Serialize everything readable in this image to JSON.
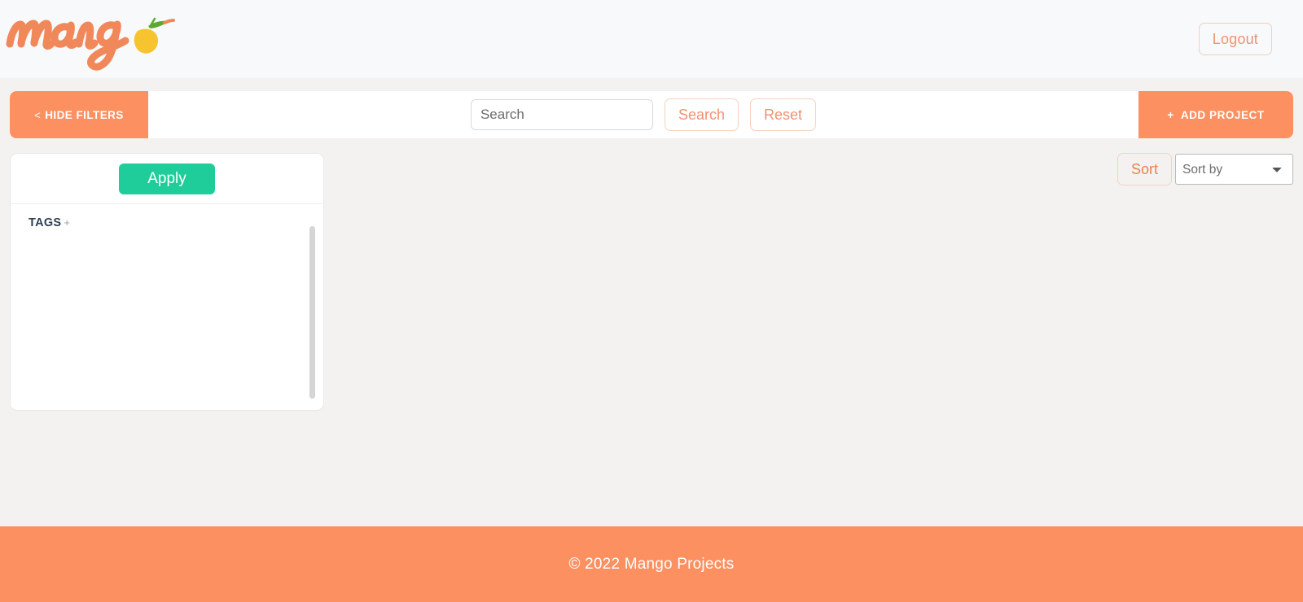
{
  "brand": {
    "logo_text": "mango",
    "logo_icon": "mango-fruit-icon",
    "orange": "#fc9060",
    "green": "#1ecd99",
    "navy": "#2e4153",
    "salmon_text": "#ef9272"
  },
  "header": {
    "logout_label": "Logout"
  },
  "toolbar": {
    "hide_filters_label": "HIDE FILTERS",
    "hide_filters_chevron": "<",
    "search_placeholder": "Search",
    "search_value": "",
    "search_button_label": "Search",
    "reset_button_label": "Reset",
    "add_project_label": "ADD PROJECT",
    "add_project_plus": "+"
  },
  "filters": {
    "apply_label": "Apply",
    "tags_label": "TAGS",
    "tags_add_icon": "+",
    "tags": []
  },
  "sort": {
    "sort_button_label": "Sort",
    "select_placeholder": "Sort by",
    "select_value": "Sort by",
    "options": [
      "Sort by"
    ]
  },
  "projects": {
    "items": [],
    "empty": true
  },
  "footer": {
    "copyright": "© 2022 Mango Projects"
  }
}
